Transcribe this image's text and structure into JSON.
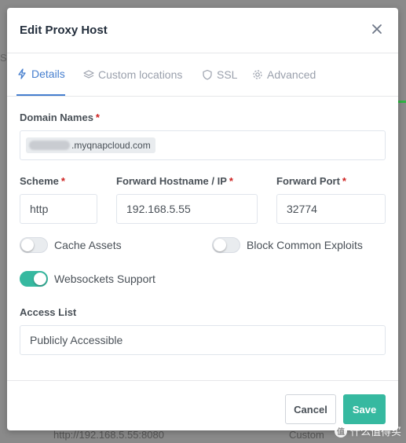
{
  "background": {
    "left_fragment": "SS",
    "bottom_left": "http://192.168.5.55:8080",
    "bottom_right": "Custom",
    "accent": "#2fb344"
  },
  "modal": {
    "title": "Edit Proxy Host",
    "close_icon": "close-icon"
  },
  "tabs": [
    {
      "label": "Details",
      "icon": "bolt-icon",
      "active": true
    },
    {
      "label": "Custom locations",
      "icon": "layers-icon",
      "active": false
    },
    {
      "label": "SSL",
      "icon": "shield-icon",
      "active": false
    },
    {
      "label": "Advanced",
      "icon": "gear-icon",
      "active": false
    }
  ],
  "form": {
    "domain_names": {
      "label": "Domain Names",
      "required": "*",
      "chip_value": ".myqnapcloud.com"
    },
    "scheme": {
      "label": "Scheme",
      "required": "*",
      "value": "http"
    },
    "forward_host": {
      "label": "Forward Hostname / IP",
      "required": "*",
      "value": "192.168.5.55"
    },
    "forward_port": {
      "label": "Forward Port",
      "required": "*",
      "value": "32774"
    },
    "toggles": [
      {
        "label": "Cache Assets",
        "on": false
      },
      {
        "label": "Block Common Exploits",
        "on": false
      },
      {
        "label": "Websockets Support",
        "on": true
      }
    ],
    "access_list": {
      "label": "Access List",
      "value": "Publicly Accessible"
    }
  },
  "footer": {
    "cancel_label": "Cancel",
    "save_label": "Save"
  },
  "watermark": {
    "badge": "值",
    "text": "什么值得买"
  },
  "colors": {
    "primary": "#467fcf",
    "teal": "#36b9a0",
    "required": "#cd201f"
  }
}
